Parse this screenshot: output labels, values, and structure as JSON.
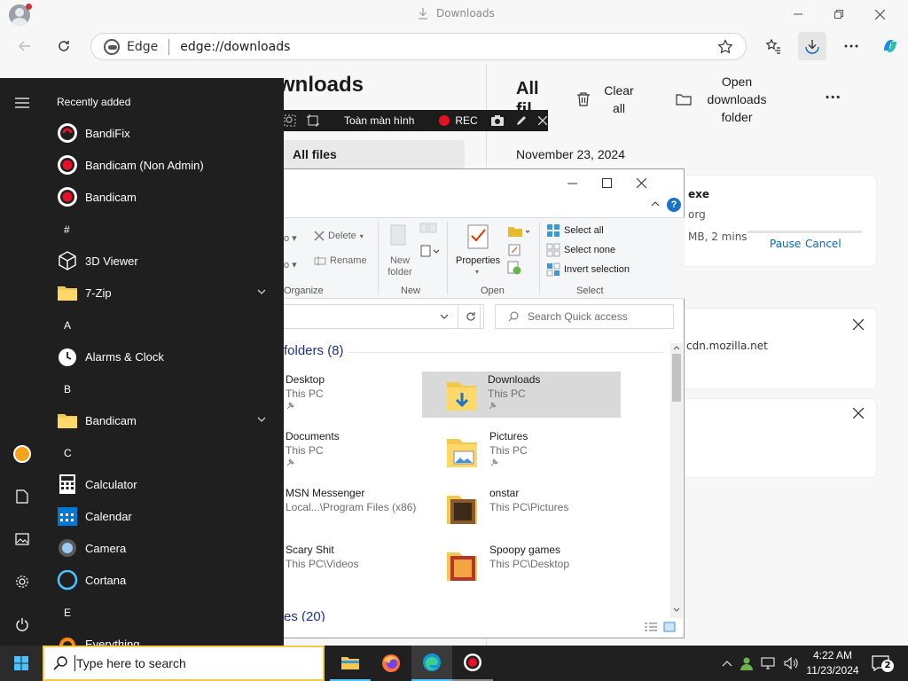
{
  "edge": {
    "tab_title": "Downloads",
    "site_label": "Edge",
    "url": "edge://downloads",
    "colors": {
      "accent": "#0067c0",
      "chrome": "#f7f7f7"
    }
  },
  "downloads": {
    "page_heading": "wnloads",
    "filter_all": "All files",
    "panel_title": "All fil",
    "clear_all": "Clear all",
    "open_folder": "Open downloads folder",
    "more": "...",
    "date_header": "November 23, 2024",
    "item1": {
      "name": "exe",
      "source": "org",
      "status": "MB, 2 mins",
      "pause": "Pause",
      "cancel": "Cancel"
    },
    "item2": {
      "source": "cdn.mozilla.net"
    }
  },
  "start_menu": {
    "section_title": "Recently added",
    "apps": [
      {
        "label": "BandiFix",
        "icon": "bandifix-icon"
      },
      {
        "label": "Bandicam (Non Admin)",
        "icon": "bandicam-icon"
      },
      {
        "label": "Bandicam",
        "icon": "bandicam-icon"
      },
      {
        "label": "3D Viewer",
        "icon": "cube-icon"
      },
      {
        "label": "7-Zip",
        "icon": "folder-icon"
      },
      {
        "label": "Alarms & Clock",
        "icon": "clock-icon"
      },
      {
        "label": "Bandicam",
        "icon": "folder-icon"
      },
      {
        "label": "Calculator",
        "icon": "calculator-icon"
      },
      {
        "label": "Calendar",
        "icon": "calendar-icon"
      },
      {
        "label": "Camera",
        "icon": "camera-icon"
      },
      {
        "label": "Cortana",
        "icon": "cortana-icon"
      },
      {
        "label": "Everything",
        "icon": "everything-icon"
      }
    ],
    "letters": [
      "#",
      "A",
      "B",
      "C",
      "E"
    ]
  },
  "bandicam_bar": {
    "mode_label": "Toàn màn hình",
    "rec_label": "REC"
  },
  "explorer": {
    "ribbon": {
      "delete": "Delete",
      "rename": "Rename",
      "organize_group": "Organize",
      "new_folder": "New folder",
      "new_group": "New",
      "properties": "Properties",
      "open_group": "Open",
      "select_all": "Select all",
      "select_none": "Select none",
      "invert_selection": "Invert selection",
      "select_group": "Select"
    },
    "search_placeholder": "Search Quick access",
    "section_folders": "folders (8)",
    "section_recent": "es (20)",
    "items": [
      {
        "name": "Desktop",
        "sub": "This PC"
      },
      {
        "name": "Downloads",
        "sub": "This PC"
      },
      {
        "name": "Documents",
        "sub": "This PC"
      },
      {
        "name": "Pictures",
        "sub": "This PC"
      },
      {
        "name": "MSN Messenger",
        "sub": "Local...\\Program Files (x86)"
      },
      {
        "name": "onstar",
        "sub": "This PC\\Pictures"
      },
      {
        "name": "Scary Shit",
        "sub": "This PC\\Videos"
      },
      {
        "name": "Spoopy games",
        "sub": "This PC\\Desktop"
      }
    ]
  },
  "taskbar": {
    "search_placeholder": "Type here to search",
    "time": "4:22 AM",
    "date": "11/23/2024",
    "notification_count": "2"
  }
}
